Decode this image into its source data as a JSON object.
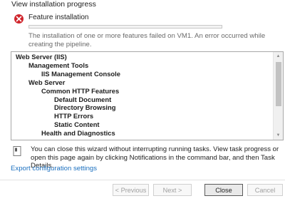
{
  "window": {
    "title": "View installation progress"
  },
  "status": {
    "icon": "error-icon",
    "feature_label": "Feature installation",
    "progress_fraction": 0.0,
    "message": "The installation of one or more features failed on VM1. An error occurred while creating the pipeline."
  },
  "tree": {
    "items": [
      {
        "label": "Web Server (IIS)",
        "level": 0
      },
      {
        "label": "Management Tools",
        "level": 1
      },
      {
        "label": "IIS Management Console",
        "level": 2
      },
      {
        "label": "Web Server",
        "level": 1
      },
      {
        "label": "Common HTTP Features",
        "level": 2
      },
      {
        "label": "Default Document",
        "level": 3
      },
      {
        "label": "Directory Browsing",
        "level": 3
      },
      {
        "label": "HTTP Errors",
        "level": 3
      },
      {
        "label": "Static Content",
        "level": 3
      },
      {
        "label": "Health and Diagnostics",
        "level": 2
      }
    ]
  },
  "note": {
    "icon": "info-note-icon",
    "text": "You can close this wizard without interrupting running tasks. View task progress or open this page again by clicking Notifications in the command bar, and then Task Details."
  },
  "export_link": "Export configuration settings",
  "buttons": {
    "previous": "< Previous",
    "next": "Next >",
    "close": "Close",
    "cancel": "Cancel"
  },
  "colors": {
    "error": "#d0262d",
    "link": "#1a6fbf"
  }
}
